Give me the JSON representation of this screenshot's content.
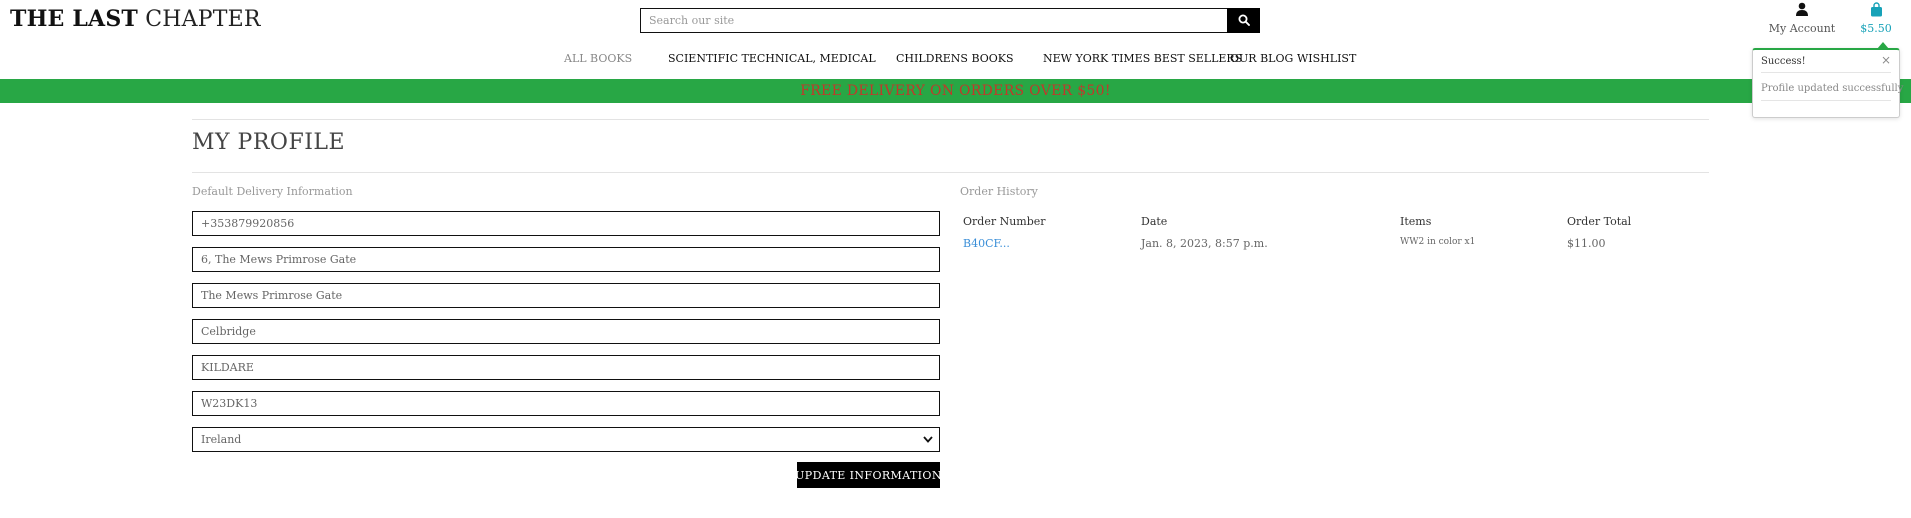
{
  "brand": {
    "bold": "THE LAST",
    "light": "CHAPTER"
  },
  "search": {
    "placeholder": "Search our site",
    "value": ""
  },
  "account": {
    "label": "My Account",
    "icon": "user-icon"
  },
  "bag": {
    "total": "$5.50",
    "icon": "shopping-bag-icon",
    "color": "#17a2b8"
  },
  "nav": {
    "items": [
      "ALL BOOKS",
      "SCIENTIFIC TECHNICAL, MEDICAL",
      "CHILDRENS BOOKS",
      "NEW YORK TIMES BEST SELLERS",
      "OUR BLOG",
      "WISHLIST"
    ]
  },
  "banner": {
    "text": "FREE DELIVERY ON ORDERS OVER $50!",
    "bg": "#28a745",
    "color": "#c0392b"
  },
  "profile": {
    "title": "MY PROFILE",
    "delivery_label": "Default Delivery Information",
    "fields": {
      "phone": "+353879920856",
      "address1": "6, The Mews Primrose Gate",
      "address2": "The Mews Primrose Gate",
      "town": "Celbridge",
      "county": "KILDARE",
      "postcode": "W23DK13",
      "country": "Ireland"
    },
    "update_label": "UPDATE INFORMATION"
  },
  "order_history": {
    "label": "Order History",
    "headers": [
      "Order Number",
      "Date",
      "Items",
      "Order Total"
    ],
    "rows": [
      {
        "number": "B40CF...",
        "date": "Jan. 8, 2023, 8:57 p.m.",
        "items": "WW2 in color x1",
        "total": "$11.00"
      }
    ]
  },
  "toast": {
    "title": "Success!",
    "message": "Profile updated successfully",
    "close": "×",
    "accent": "#28a745"
  }
}
